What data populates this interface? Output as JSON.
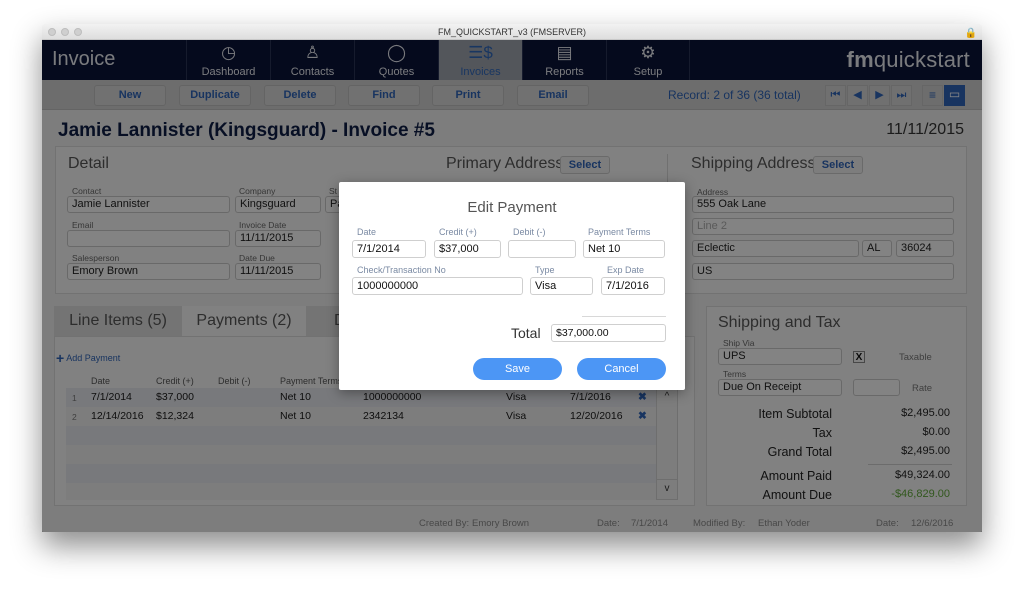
{
  "window": {
    "title": "FM_QUICKSTART_v3 (FMSERVER)"
  },
  "navbar": {
    "app_title": "Invoice",
    "brand_bold": "fm",
    "brand_rest": "quickstart",
    "items": [
      {
        "label": "Dashboard",
        "icon": "clock-icon",
        "glyph": "◷"
      },
      {
        "label": "Contacts",
        "icon": "person-icon",
        "glyph": "♙"
      },
      {
        "label": "Quotes",
        "icon": "speech-bubble-icon",
        "glyph": "◯"
      },
      {
        "label": "Invoices",
        "icon": "invoice-dollar-icon",
        "glyph": "☰$"
      },
      {
        "label": "Reports",
        "icon": "report-sheet-icon",
        "glyph": "▤"
      },
      {
        "label": "Setup",
        "icon": "gear-icon",
        "glyph": "⚙"
      }
    ],
    "active": "Invoices"
  },
  "toolbar": {
    "buttons": [
      "New",
      "Duplicate",
      "Delete",
      "Find",
      "Print",
      "Email"
    ],
    "record_text": "Record:  2 of 36 (36 total)",
    "nav": [
      "⏮",
      "◀",
      "▶",
      "⏭"
    ],
    "view_list_glyph": "≡",
    "view_form_glyph": "▭"
  },
  "header": {
    "title": "Jamie Lannister (Kingsguard) - Invoice #5",
    "date": "11/11/2015"
  },
  "detail": {
    "title": "Detail",
    "contact_label": "Contact",
    "contact": "Jamie Lannister",
    "company_label": "Company",
    "company": "Kingsguard",
    "status_label": "St",
    "status": "Pa",
    "email_label": "Email",
    "email": "",
    "invoice_date_label": "Invoice Date",
    "invoice_date": "11/11/2015",
    "salesperson_label": "Salesperson",
    "salesperson": "Emory Brown",
    "date_due_label": "Date Due",
    "date_due": "11/11/2015"
  },
  "primary_address": {
    "title": "Primary Address",
    "select_label": "Select"
  },
  "shipping_address": {
    "title": "Shipping Address",
    "select_label": "Select",
    "address_label": "Address",
    "line1": "555 Oak Lane",
    "line2_placeholder": "Line 2",
    "city": "Eclectic",
    "state": "AL",
    "zip": "36024",
    "country": "US"
  },
  "tabs": [
    {
      "label": "Line Items  (5)"
    },
    {
      "label": "Payments (2)"
    },
    {
      "label": "D"
    }
  ],
  "payments": {
    "add_label": "Add Payment",
    "columns": [
      "Date",
      "Credit (+)",
      "Debit (-)",
      "Payment Terms"
    ],
    "rows": [
      {
        "n": "1",
        "date": "7/1/2014",
        "credit": "$37,000",
        "debit": "",
        "terms": "Net 10",
        "check": "1000000000",
        "type": "Visa",
        "exp": "7/1/2016"
      },
      {
        "n": "2",
        "date": "12/14/2016",
        "credit": "$12,324",
        "debit": "",
        "terms": "Net 10",
        "check": "2342134",
        "type": "Visa",
        "exp": "12/20/2016"
      }
    ],
    "scroll_up": "^",
    "scroll_down": "v"
  },
  "shipping_tax": {
    "title": "Shipping and Tax",
    "ship_via_label": "Ship Via",
    "ship_via": "UPS",
    "taxable_check": "X",
    "taxable_label": "Taxable",
    "terms_label": "Terms",
    "terms": "Due On Receipt",
    "rate": "",
    "rate_label": "Rate",
    "item_subtotal_label": "Item Subtotal",
    "item_subtotal": "$2,495.00",
    "tax_label": "Tax",
    "tax": "$0.00",
    "grand_total_label": "Grand Total",
    "grand_total": "$2,495.00",
    "amount_paid_label": "Amount Paid",
    "amount_paid": "$49,324.00",
    "amount_due_label": "Amount Due",
    "amount_due": "-$46,829.00",
    "amount_due_color": "#5fa63a"
  },
  "footer": {
    "created_by_label": "Created By:",
    "created_by": "Emory Brown",
    "created_date_label": "Date:",
    "created_date": "7/1/2014",
    "modified_by_label": "Modified By:",
    "modified_by": "Ethan Yoder",
    "modified_date_label": "Date:",
    "modified_date": "12/6/2016"
  },
  "modal": {
    "title": "Edit Payment",
    "date_label": "Date",
    "date": "7/1/2014",
    "credit_label": "Credit (+)",
    "credit": "$37,000",
    "debit_label": "Debit (-)",
    "debit": "",
    "terms_label": "Payment Terms",
    "terms": "Net 10",
    "check_label": "Check/Transaction No",
    "check": "1000000000",
    "type_label": "Type",
    "type": "Visa",
    "exp_label": "Exp Date",
    "exp": "7/1/2016",
    "total_label": "Total",
    "total": "$37,000.00",
    "save_label": "Save",
    "cancel_label": "Cancel"
  }
}
